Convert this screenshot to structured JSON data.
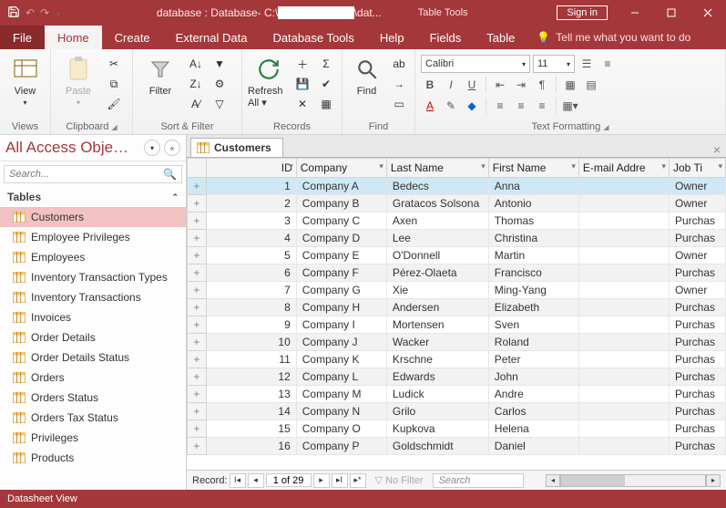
{
  "titlebar": {
    "title_prefix": "database : Database- C:\\",
    "title_suffix": "\\dat...",
    "table_tools": "Table Tools",
    "sign_in": "Sign in"
  },
  "menu": {
    "file": "File",
    "home": "Home",
    "create": "Create",
    "external_data": "External Data",
    "database_tools": "Database Tools",
    "help": "Help",
    "fields": "Fields",
    "table": "Table",
    "tell_me": "Tell me what you want to do"
  },
  "ribbon": {
    "view": "View",
    "paste": "Paste",
    "filter": "Filter",
    "refresh_all": "Refresh All",
    "find": "Find",
    "groups": {
      "views": "Views",
      "clipboard": "Clipboard",
      "sortfilter": "Sort & Filter",
      "records": "Records",
      "find": "Find",
      "textfmt": "Text Formatting"
    },
    "font_name": "Calibri",
    "font_size": "11"
  },
  "navpane": {
    "title": "All Access Obje…",
    "search_placeholder": "Search...",
    "section": "Tables",
    "items": [
      "Customers",
      "Employee Privileges",
      "Employees",
      "Inventory Transaction Types",
      "Inventory Transactions",
      "Invoices",
      "Order Details",
      "Order Details Status",
      "Orders",
      "Orders Status",
      "Orders Tax Status",
      "Privileges",
      "Products"
    ]
  },
  "tab": {
    "name": "Customers"
  },
  "columns": [
    "ID",
    "Company",
    "Last Name",
    "First Name",
    "E-mail Addre",
    "Job Ti"
  ],
  "rows": [
    {
      "id": 1,
      "company": "Company A",
      "last": "Bedecs",
      "first": "Anna",
      "email": "",
      "job": "Owner"
    },
    {
      "id": 2,
      "company": "Company B",
      "last": "Gratacos Solsona",
      "first": "Antonio",
      "email": "",
      "job": "Owner"
    },
    {
      "id": 3,
      "company": "Company C",
      "last": "Axen",
      "first": "Thomas",
      "email": "",
      "job": "Purchas"
    },
    {
      "id": 4,
      "company": "Company D",
      "last": "Lee",
      "first": "Christina",
      "email": "",
      "job": "Purchas"
    },
    {
      "id": 5,
      "company": "Company E",
      "last": "O'Donnell",
      "first": "Martin",
      "email": "",
      "job": "Owner"
    },
    {
      "id": 6,
      "company": "Company F",
      "last": "Pérez-Olaeta",
      "first": "Francisco",
      "email": "",
      "job": "Purchas"
    },
    {
      "id": 7,
      "company": "Company G",
      "last": "Xie",
      "first": "Ming-Yang",
      "email": "",
      "job": "Owner"
    },
    {
      "id": 8,
      "company": "Company H",
      "last": "Andersen",
      "first": "Elizabeth",
      "email": "",
      "job": "Purchas"
    },
    {
      "id": 9,
      "company": "Company I",
      "last": "Mortensen",
      "first": "Sven",
      "email": "",
      "job": "Purchas"
    },
    {
      "id": 10,
      "company": "Company J",
      "last": "Wacker",
      "first": "Roland",
      "email": "",
      "job": "Purchas"
    },
    {
      "id": 11,
      "company": "Company K",
      "last": "Krschne",
      "first": "Peter",
      "email": "",
      "job": "Purchas"
    },
    {
      "id": 12,
      "company": "Company L",
      "last": "Edwards",
      "first": "John",
      "email": "",
      "job": "Purchas"
    },
    {
      "id": 13,
      "company": "Company M",
      "last": "Ludick",
      "first": "Andre",
      "email": "",
      "job": "Purchas"
    },
    {
      "id": 14,
      "company": "Company N",
      "last": "Grilo",
      "first": "Carlos",
      "email": "",
      "job": "Purchas"
    },
    {
      "id": 15,
      "company": "Company O",
      "last": "Kupkova",
      "first": "Helena",
      "email": "",
      "job": "Purchas"
    },
    {
      "id": 16,
      "company": "Company P",
      "last": "Goldschmidt",
      "first": "Daniel",
      "email": "",
      "job": "Purchas"
    }
  ],
  "recordnav": {
    "label": "Record:",
    "position": "1 of 29",
    "no_filter": "No Filter",
    "search": "Search"
  },
  "statusbar": {
    "text": "Datasheet View"
  }
}
